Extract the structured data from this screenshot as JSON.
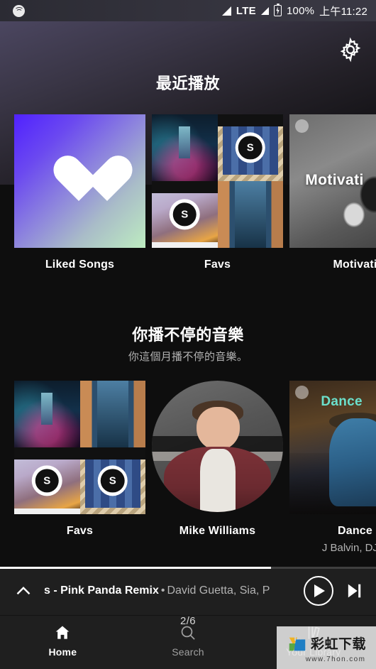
{
  "statusbar": {
    "spotify_icon": "spotify-logo-icon",
    "network": "LTE",
    "battery": "100%",
    "time": "上午11:22"
  },
  "header": {
    "settings_icon": "gear-icon",
    "title": "最近播放"
  },
  "recently_played": [
    {
      "label": "Liked Songs",
      "art": "liked-songs-gradient-heart"
    },
    {
      "label": "Favs",
      "art": "four-album-collage"
    },
    {
      "label": "Motivati",
      "art": "runner-photo",
      "overlay_text": "Motivati"
    }
  ],
  "on_repeat": {
    "title": "你播不停的音樂",
    "subtitle": "你這個月播不停的音樂。",
    "items": [
      {
        "label": "Favs",
        "sub": "",
        "art": "four-album-collage"
      },
      {
        "label": "Mike Williams",
        "sub": "",
        "art": "artist-portrait-circle"
      },
      {
        "label": "Dance ",
        "sub": "J Balvin, DJ S",
        "art": "dance-party-cover",
        "overlay_text": "Dance "
      }
    ]
  },
  "player": {
    "expand_icon": "chevron-up-icon",
    "track_name": "s - Pink Panda Remix",
    "separator": "•",
    "artists": "David Guetta, Sia, P",
    "play_icon": "play-icon",
    "next_icon": "skip-next-icon",
    "progress_percent": 72
  },
  "nav": [
    {
      "label": "Home",
      "icon": "home-icon",
      "active": true,
      "badge": ""
    },
    {
      "label": "Search",
      "icon": "search-icon",
      "active": false,
      "badge": "2/6"
    },
    {
      "label": "Your Library",
      "icon": "library-icon",
      "active": false,
      "badge": ""
    }
  ],
  "watermark": {
    "title": "彩虹下载",
    "url": "www.7hon.com"
  },
  "colors": {
    "background": "#0e0e0e",
    "bar": "#1f1f1f",
    "text_primary": "#ffffff",
    "text_secondary": "#b3b3b3",
    "accent_purple": "#5021ff",
    "accent_mint": "#bdecc0",
    "dance_teal": "#6be0cc"
  }
}
